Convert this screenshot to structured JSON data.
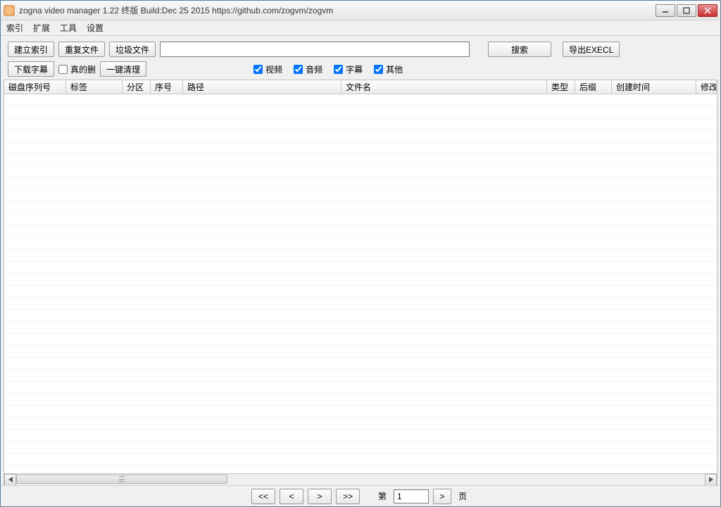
{
  "window": {
    "title": "zogna video manager 1.22 终版 Build:Dec 25 2015  https://github.com/zogvm/zogvm"
  },
  "menu": {
    "index": "索引",
    "extend": "扩展",
    "tools": "工具",
    "settings": "设置"
  },
  "toolbar": {
    "build_index": "建立索引",
    "duplicate_files": "重复文件",
    "trash_files": "垃圾文件",
    "search_value": "",
    "search_btn": "搜索",
    "export_btn": "导出EXECL",
    "download_subtitle": "下载字幕",
    "really_delete": "真的删",
    "one_click_clean": "一键清理"
  },
  "filters": {
    "video": "视频",
    "audio": "音频",
    "subtitle": "字幕",
    "other": "其他"
  },
  "columns": {
    "disk_serial": "磁盘序列号",
    "label": "标签",
    "partition": "分区",
    "seq": "序号",
    "path": "路径",
    "filename": "文件名",
    "type": "类型",
    "ext": "后缀",
    "create_time": "创建时间",
    "modify": "修改"
  },
  "pager": {
    "first": "<<",
    "prev": "<",
    "next": ">",
    "last": ">>",
    "page_label": "第",
    "page_value": "1",
    "go": ">",
    "page_suffix": "页"
  }
}
